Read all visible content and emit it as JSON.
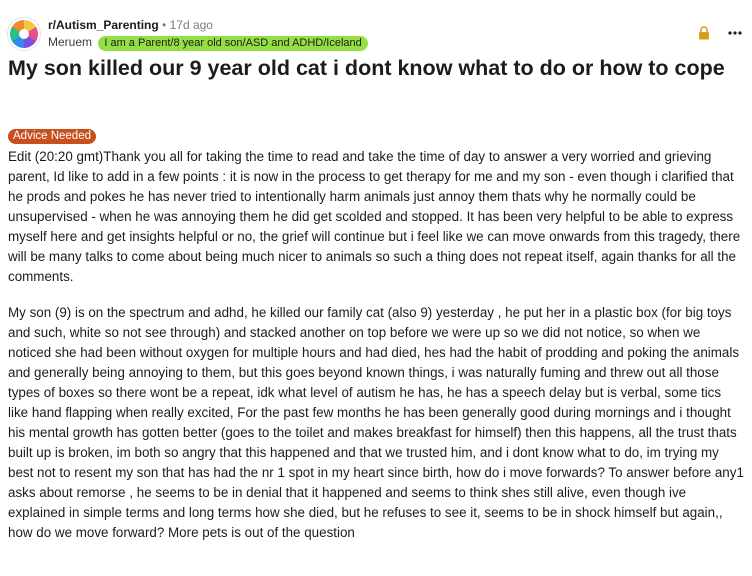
{
  "post": {
    "subreddit": "r/Autism_Parenting",
    "separator": "•",
    "time_ago": "17d ago",
    "author": "Meruem",
    "user_flair": "I am a Parent/8 year old son/ASD and ADHD/Iceland",
    "title": "My son killed our 9 year old cat i dont know what to do or how to cope",
    "post_flair": "Advice Needed",
    "paragraphs": [
      "Edit (20:20 gmt)Thank you all for taking the time to read and take the time of day to answer a very worried and grieving parent, Id like to add in a few points : it is now in the process to get therapy for me and my son - even though i clarified that he prods and pokes he has never tried to intentionally harm animals just annoy them thats why he normally could be unsupervised - when he was annoying them he did get scolded and stopped. It has been very helpful to be able to express myself here and get insights helpful or no, the grief will continue but i feel like we can move onwards from this tragedy, there will be many talks to come about being much nicer to animals so such a thing does not repeat itself, again thanks for all the comments.",
      "My son (9) is on the spectrum and adhd, he killed our family cat (also 9) yesterday , he put her in a plastic box (for big toys and such, white so not see through) and stacked another on top before we were up so we did not notice, so when we noticed she had been without oxygen for multiple hours and had died, hes had the habit of prodding and poking the animals and generally being annoying to them, but this goes beyond known things, i was naturally fuming and threw out all those types of boxes so there wont be a repeat, idk what level of autism he has, he has a speech delay but is verbal, some tics like hand flapping when really excited, For the past few months he has been generally good during mornings and i thought his mental growth has gotten better (goes to the toilet and makes breakfast for himself) then this happens, all the trust thats built up is broken, im both so angry that this happened and that we trusted him, and i dont know what to do, im trying my best not to resent my son that has had the nr 1 spot in my heart since birth, how do i move forwards? To answer before any1 asks about remorse , he seems to be in denial that it happened and seems to think shes still alive, even though ive explained in simple terms and long terms how she died, but he refuses to see it, seems to be in shock himself but again,, how do we move forward? More pets is out of the question"
    ],
    "icons": {
      "lock": "lock-icon",
      "more": "more-options-icon",
      "avatar": "subreddit-avatar"
    },
    "colors": {
      "user_flair_bg": "#94e044",
      "post_flair_bg": "#c8501e",
      "lock_color": "#d4a017"
    }
  }
}
